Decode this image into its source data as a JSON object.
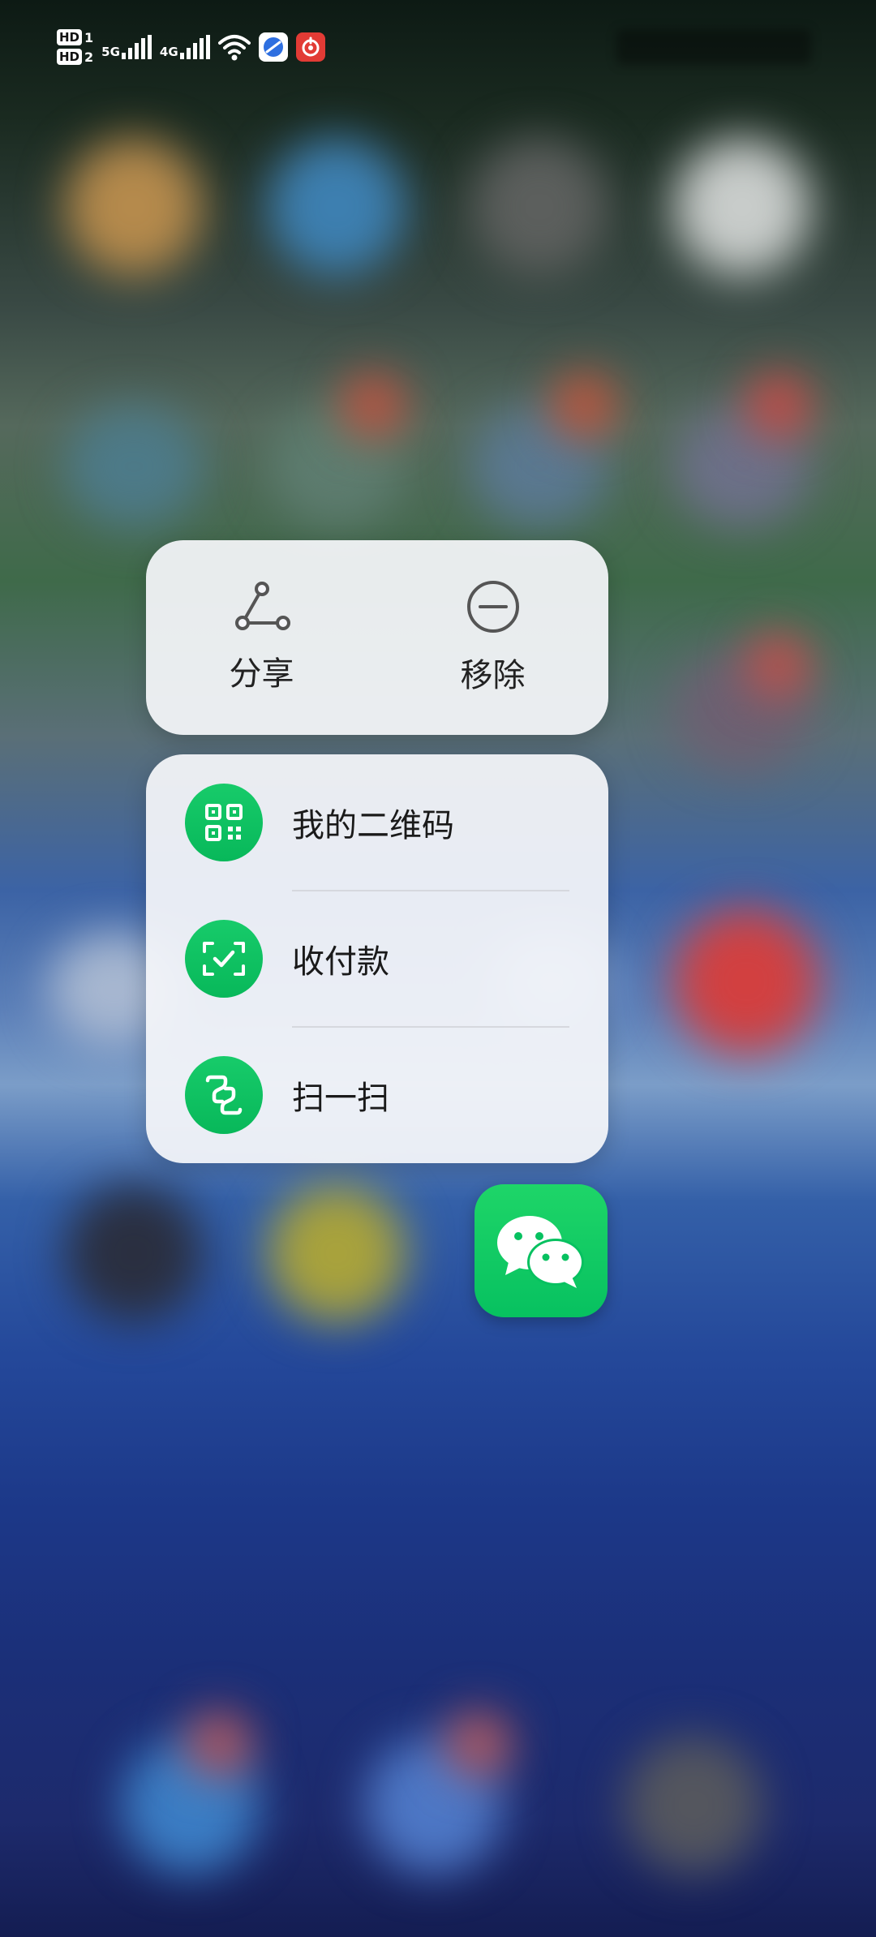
{
  "status_bar": {
    "sim1": "HD",
    "sim1_index": "1",
    "sim2": "HD",
    "sim2_index": "2",
    "network1": "5G",
    "network2": "4G",
    "icons": [
      "signal-icon",
      "signal-icon",
      "wifi-icon",
      "browser-app-icon",
      "netease-music-app-icon"
    ]
  },
  "context_menu": {
    "top_actions": [
      {
        "label": "分享",
        "icon": "share-icon"
      },
      {
        "label": "移除",
        "icon": "remove-icon"
      }
    ],
    "items": [
      {
        "label": "我的二维码",
        "icon": "qr-code-icon"
      },
      {
        "label": "收付款",
        "icon": "payment-scan-icon"
      },
      {
        "label": "扫一扫",
        "icon": "scan-icon"
      }
    ]
  },
  "app": {
    "icon": "wechat-icon"
  },
  "colors": {
    "wechat_green": "#07c160",
    "panel_bg": "#f5f6fa",
    "icon_gray": "#555555"
  }
}
